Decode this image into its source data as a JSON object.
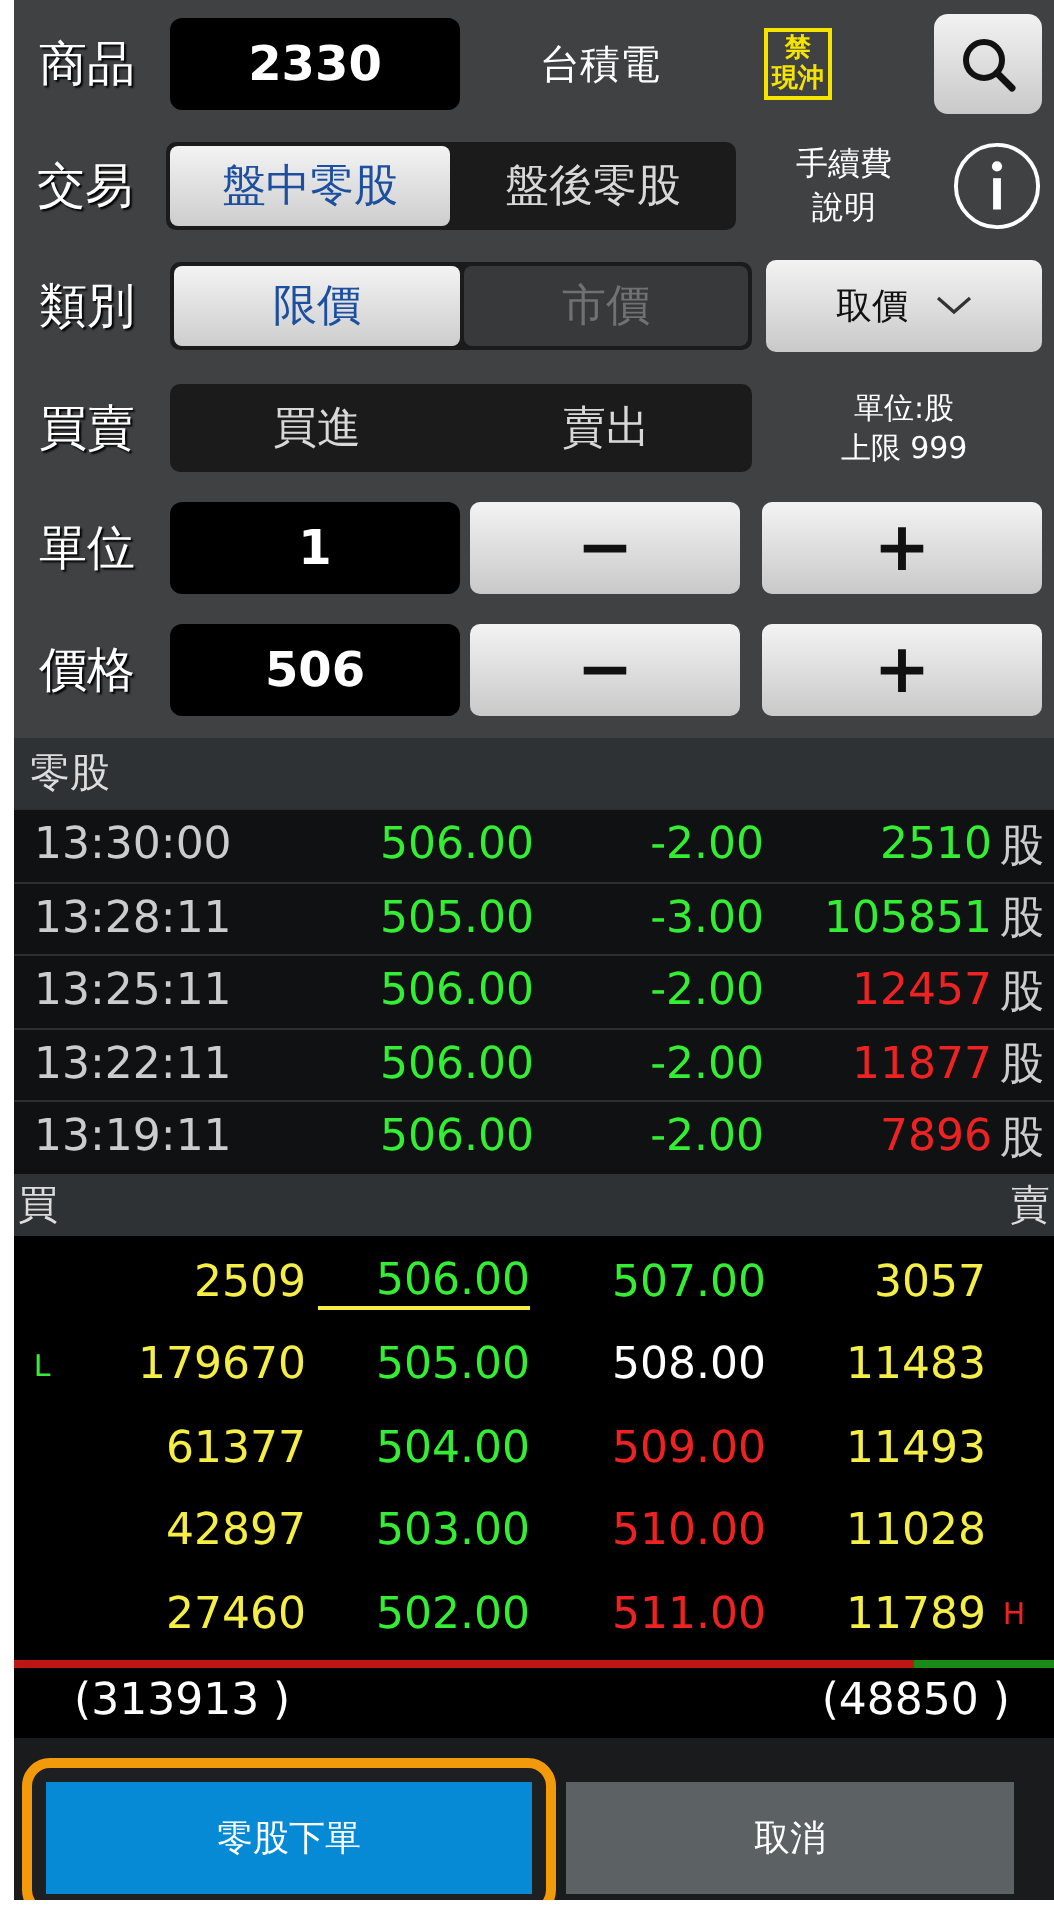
{
  "product": {
    "label": "商品",
    "code": "2330",
    "name": "台積電",
    "badge": [
      "禁",
      "現沖"
    ]
  },
  "trade": {
    "label": "交易",
    "options": [
      {
        "label": "盤中零股",
        "selected": true
      },
      {
        "label": "盤後零股",
        "selected": false
      }
    ],
    "fee_link": [
      "手續費",
      "說明"
    ]
  },
  "category": {
    "label": "類別",
    "options": [
      {
        "label": "限價",
        "selected": true,
        "disabled": false
      },
      {
        "label": "市價",
        "selected": false,
        "disabled": true
      }
    ],
    "price_picker": "取價"
  },
  "side": {
    "label": "買賣",
    "options": [
      {
        "label": "買進",
        "selected": false
      },
      {
        "label": "賣出",
        "selected": false
      }
    ],
    "note": [
      "單位:股",
      "上限 999"
    ]
  },
  "steppers": [
    {
      "label": "單位",
      "value": "1",
      "minus": "−",
      "plus": "+"
    },
    {
      "label": "價格",
      "value": "506",
      "minus": "−",
      "plus": "+"
    }
  ],
  "ticks": {
    "title": "零股",
    "rows": [
      {
        "time": "13:30:00",
        "price": "506.00",
        "change": "-2.00",
        "volume": "2510",
        "color": "#33ee33",
        "unit": "股"
      },
      {
        "time": "13:28:11",
        "price": "505.00",
        "change": "-3.00",
        "volume": "105851",
        "color": "#33ee33",
        "unit": "股"
      },
      {
        "time": "13:25:11",
        "price": "506.00",
        "change": "-2.00",
        "volume": "12457",
        "color": "#ee2222",
        "unit": "股"
      },
      {
        "time": "13:22:11",
        "price": "506.00",
        "change": "-2.00",
        "volume": "11877",
        "color": "#ee2222",
        "unit": "股"
      },
      {
        "time": "13:19:11",
        "price": "506.00",
        "change": "-2.00",
        "volume": "7896",
        "color": "#ee2222",
        "unit": "股"
      }
    ]
  },
  "book": {
    "bid_label": "買",
    "ask_label": "賣",
    "rows": [
      {
        "bid_mark": "",
        "bid_qty": "2509",
        "bid_price": "506.00",
        "underlined": true,
        "ask_price": "507.00",
        "color": "#33ee33",
        "ask_qty": "3057",
        "ask_mark": ""
      },
      {
        "bid_mark": "L",
        "bid_qty": "179670",
        "bid_price": "505.00",
        "underlined": false,
        "ask_price": "508.00",
        "color": "#ffffff",
        "ask_qty": "11483",
        "ask_mark": ""
      },
      {
        "bid_mark": "",
        "bid_qty": "61377",
        "bid_price": "504.00",
        "underlined": false,
        "ask_price": "509.00",
        "color": "#ee2222",
        "ask_qty": "11493",
        "ask_mark": ""
      },
      {
        "bid_mark": "",
        "bid_qty": "42897",
        "bid_price": "503.00",
        "underlined": false,
        "ask_price": "510.00",
        "color": "#ee2222",
        "ask_qty": "11028",
        "ask_mark": ""
      },
      {
        "bid_mark": "",
        "bid_qty": "27460",
        "bid_price": "502.00",
        "underlined": false,
        "ask_price": "511.00",
        "color": "#ee2222",
        "ask_qty": "11789",
        "ask_mark": "H"
      }
    ],
    "ratio_bar": {
      "level": 0.865
    },
    "bid_total": "(313913 )",
    "ask_total": "(48850 )"
  },
  "buttons": [
    {
      "label": "零股下單",
      "kind": "primary",
      "highlighted": true
    },
    {
      "label": "取消",
      "kind": "secondary",
      "highlighted": false
    }
  ]
}
